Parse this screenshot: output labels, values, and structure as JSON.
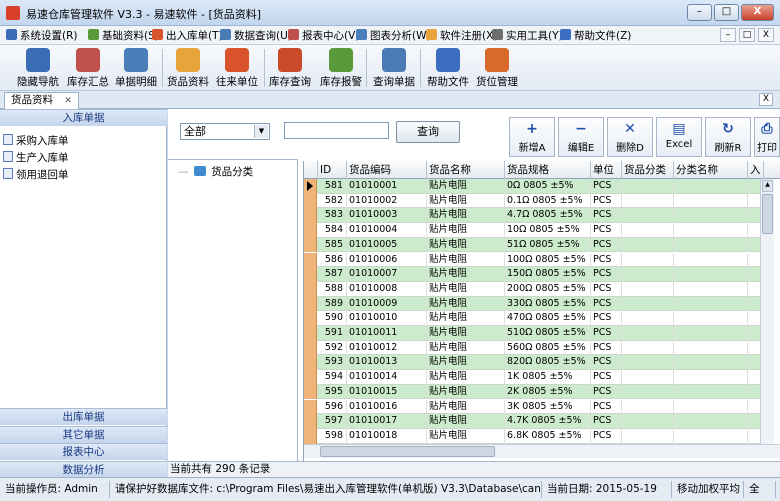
{
  "window": {
    "title": "易速仓库管理软件 V3.3 - 易速软件 - [货品资料]",
    "controls": [
      "–",
      "□",
      "X"
    ]
  },
  "menu": [
    {
      "label": "系统设置(R)"
    },
    {
      "label": "基础资料(S)"
    },
    {
      "label": "出入库单(T)"
    },
    {
      "label": "数据查询(U)"
    },
    {
      "label": "报表中心(V)"
    },
    {
      "label": "图表分析(W)"
    },
    {
      "label": "软件注册(X)"
    },
    {
      "label": "实用工具(Y)"
    },
    {
      "label": "帮助文件(Z)"
    }
  ],
  "mdi_controls": [
    "–",
    "□",
    "X"
  ],
  "toolbar": [
    {
      "label": "隐藏导航",
      "icon": "monitor-icon",
      "color": "#3a6db5"
    },
    {
      "label": "库存汇总",
      "icon": "chart-icon",
      "color": "#c0504d"
    },
    {
      "label": "单据明细",
      "icon": "bar-chart-icon",
      "color": "#4a7ebb"
    },
    {
      "label": "货品资料",
      "icon": "box-icon",
      "color": "#e8a33c"
    },
    {
      "label": "往来单位",
      "icon": "people-icon",
      "color": "#d9532c"
    },
    {
      "label": "库存查询",
      "icon": "stock-icon",
      "color": "#c94b2c"
    },
    {
      "label": "库存报警",
      "icon": "alarm-icon",
      "color": "#5a9a3a"
    },
    {
      "label": "查询单据",
      "icon": "magnifier-icon",
      "color": "#4b7bb4"
    },
    {
      "label": "帮助文件",
      "icon": "help-icon",
      "color": "#3c6fc1"
    },
    {
      "label": "货位管理",
      "icon": "location-icon",
      "color": "#d86b2a"
    }
  ],
  "tab": {
    "label": "货品资料",
    "close": "✕"
  },
  "nav": {
    "active_section": "入库单据",
    "items": [
      "采购入库单",
      "生产入库单",
      "领用退回单"
    ],
    "sections": [
      "出库单据",
      "其它单据",
      "报表中心",
      "数据分析"
    ]
  },
  "filter": {
    "select_value": "全部",
    "search_value": "",
    "query_label": "查询"
  },
  "actions": [
    {
      "label": "新增A",
      "icon": "plus-icon",
      "glyph": "+"
    },
    {
      "label": "编辑E",
      "icon": "minus-icon",
      "glyph": "−"
    },
    {
      "label": "删除D",
      "icon": "delete-icon",
      "glyph": "✕"
    },
    {
      "label": "Excel",
      "icon": "excel-icon",
      "glyph": "▤"
    },
    {
      "label": "刷新R",
      "icon": "refresh-icon",
      "glyph": "↻"
    },
    {
      "label": "打印",
      "icon": "print-icon",
      "glyph": "⎙"
    }
  ],
  "tree": {
    "root": "货品分类"
  },
  "grid": {
    "columns": [
      "ID",
      "货品编码",
      "货品名称",
      "货品规格",
      "单位",
      "货品分类",
      "分类名称",
      "入"
    ],
    "rows": [
      [
        "581",
        "01010001",
        "贴片电阻",
        "0Ω    0805  ±5%",
        "PCS"
      ],
      [
        "582",
        "01010002",
        "贴片电阻",
        "0.1Ω  0805  ±5%",
        "PCS"
      ],
      [
        "583",
        "01010003",
        "贴片电阻",
        "4.7Ω  0805  ±5%",
        "PCS"
      ],
      [
        "584",
        "01010004",
        "贴片电阻",
        "10Ω   0805  ±5%",
        "PCS"
      ],
      [
        "585",
        "01010005",
        "贴片电阻",
        "51Ω   0805  ±5%",
        "PCS"
      ],
      [
        "586",
        "01010006",
        "贴片电阻",
        "100Ω  0805  ±5%",
        "PCS"
      ],
      [
        "587",
        "01010007",
        "贴片电阻",
        "150Ω  0805  ±5%",
        "PCS"
      ],
      [
        "588",
        "01010008",
        "贴片电阻",
        "200Ω  0805  ±5%",
        "PCS"
      ],
      [
        "589",
        "01010009",
        "贴片电阻",
        "330Ω  0805  ±5%",
        "PCS"
      ],
      [
        "590",
        "01010010",
        "贴片电阻",
        "470Ω  0805  ±5%",
        "PCS"
      ],
      [
        "591",
        "01010011",
        "贴片电阻",
        "510Ω  0805  ±5%",
        "PCS"
      ],
      [
        "592",
        "01010012",
        "贴片电阻",
        "560Ω  0805  ±5%",
        "PCS"
      ],
      [
        "593",
        "01010013",
        "贴片电阻",
        "820Ω  0805  ±5%",
        "PCS"
      ],
      [
        "594",
        "01010014",
        "贴片电阻",
        "1K    0805  ±5%",
        "PCS"
      ],
      [
        "595",
        "01010015",
        "贴片电阻",
        "2K    0805  ±5%",
        "PCS"
      ],
      [
        "596",
        "01010016",
        "贴片电阻",
        "3K    0805  ±5%",
        "PCS"
      ],
      [
        "597",
        "01010017",
        "贴片电阻",
        "4.7K  0805  ±5%",
        "PCS"
      ],
      [
        "598",
        "01010018",
        "贴片电阻",
        "6.8K  0805  ±5%",
        "PCS"
      ]
    ],
    "row_colors": [
      "#ccebcc",
      "#ffffff"
    ],
    "count_text": "当前共有 290 条记录"
  },
  "status": {
    "operator": "当前操作员: Admin",
    "backup": "请保护好数据库文件: c:\\Program Files\\易速出入库管理软件(单机版) V3.3\\Database\\cangk",
    "date": "当前日期: 2015-05-19",
    "method": "移动加权平均",
    "extra": "全"
  }
}
